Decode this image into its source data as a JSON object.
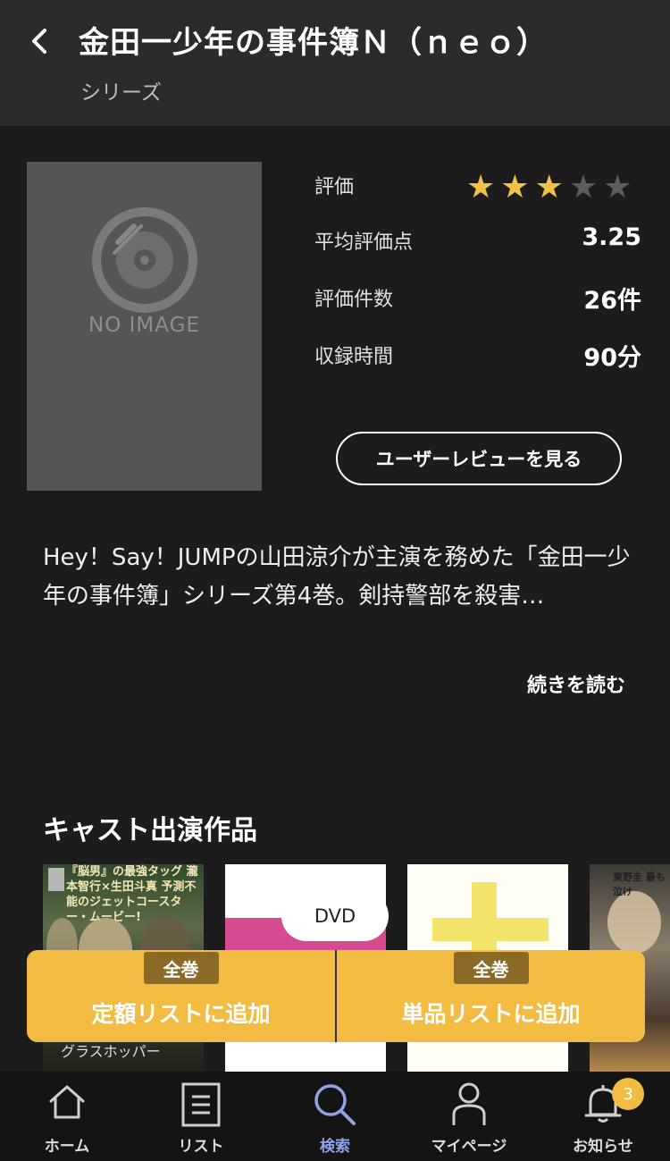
{
  "header": {
    "title": "金田一少年の事件簿Ｎ（ｎｅｏ）",
    "subtitle": "シリーズ"
  },
  "cover": {
    "placeholder": "NO IMAGE"
  },
  "info": {
    "rating_label": "評価",
    "rating_stars": 3,
    "rating_max": 5,
    "average_label": "平均評価点",
    "average_value": "3.25",
    "count_label": "評価件数",
    "count_value": "26件",
    "duration_label": "収録時間",
    "duration_value": "90分"
  },
  "review_button": "ユーザーレビューを見る",
  "description": "Hey！Say！JUMPの山田涼介が主演を務めた「金田一少年の事件簿」シリーズ第4巻。剣持警部を殺害…",
  "read_more": "続きを読む",
  "cast_section": {
    "title": "キャスト出演作品",
    "items": [
      {
        "caption": "『脳男』の最強タッグ 瀧本智行×生田斗真 予測不能のジェットコースター・ムービー!",
        "bottom": "グラスホッパー"
      },
      {
        "caption": ""
      },
      {
        "caption": ""
      },
      {
        "caption": "東野圭 最も泣け"
      }
    ]
  },
  "format_pill": "DVD",
  "add_bar": {
    "left": {
      "tag": "全巻",
      "label": "定額リストに追加"
    },
    "right": {
      "tag": "全巻",
      "label": "単品リストに追加"
    }
  },
  "nav": {
    "items": [
      {
        "label": "ホーム",
        "icon": "home-icon"
      },
      {
        "label": "リスト",
        "icon": "list-icon"
      },
      {
        "label": "検索",
        "icon": "search-icon"
      },
      {
        "label": "マイページ",
        "icon": "person-icon"
      },
      {
        "label": "お知らせ",
        "icon": "bell-icon"
      }
    ],
    "active": "検索",
    "notification_count": "3"
  },
  "colors": {
    "accent": "#f2bb42",
    "background": "#1c1c1c",
    "header": "#2b2b2b",
    "active_nav": "#8fa3e6",
    "star_on": "#f1c24a",
    "star_off": "#5c5c5c"
  }
}
